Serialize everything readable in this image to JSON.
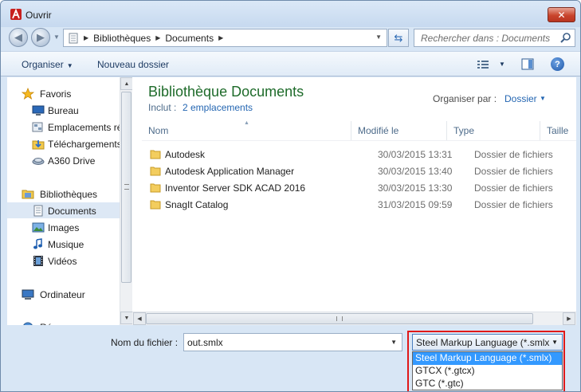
{
  "window": {
    "title": "Ouvrir",
    "close_label": "✕"
  },
  "address": {
    "segments": [
      "Bibliothèques",
      "Documents"
    ],
    "search_placeholder": "Rechercher dans : Documents"
  },
  "toolbar": {
    "organize_label": "Organiser",
    "new_folder_label": "Nouveau dossier",
    "help_label": "?"
  },
  "sidebar": {
    "items": [
      {
        "label": "Favoris",
        "icon": "star-icon",
        "indent": false
      },
      {
        "label": "Bureau",
        "icon": "desktop-icon",
        "indent": true
      },
      {
        "label": "Emplacements ré",
        "icon": "recent-places-icon",
        "indent": true
      },
      {
        "label": "Téléchargements",
        "icon": "downloads-icon",
        "indent": true
      },
      {
        "label": "A360 Drive",
        "icon": "cloud-drive-icon",
        "indent": true
      },
      {
        "label": "Bibliothèques",
        "icon": "libraries-icon",
        "indent": false
      },
      {
        "label": "Documents",
        "icon": "documents-icon",
        "indent": true,
        "selected": true
      },
      {
        "label": "Images",
        "icon": "images-icon",
        "indent": true
      },
      {
        "label": "Musique",
        "icon": "music-icon",
        "indent": true
      },
      {
        "label": "Vidéos",
        "icon": "videos-icon",
        "indent": true
      },
      {
        "label": "Ordinateur",
        "icon": "computer-icon",
        "indent": false
      },
      {
        "label": "Ré",
        "icon": "network-icon",
        "indent": false
      }
    ]
  },
  "library": {
    "title": "Bibliothèque Documents",
    "include_label": "Inclut :",
    "include_link": "2 emplacements",
    "arrange_label": "Organiser par :",
    "arrange_value": "Dossier"
  },
  "columns": [
    "Nom",
    "Modifié le",
    "Type",
    "Taille"
  ],
  "files": [
    {
      "name": "Autodesk",
      "modified": "30/03/2015 13:31",
      "type": "Dossier de fichiers"
    },
    {
      "name": "Autodesk Application Manager",
      "modified": "30/03/2015 13:40",
      "type": "Dossier de fichiers"
    },
    {
      "name": "Inventor Server SDK ACAD 2016",
      "modified": "30/03/2015 13:30",
      "type": "Dossier de fichiers"
    },
    {
      "name": "SnagIt Catalog",
      "modified": "31/03/2015 09:59",
      "type": "Dossier de fichiers"
    }
  ],
  "bottom": {
    "filename_label": "Nom du fichier :",
    "filename_value": "out.smlx",
    "filetype_selected": "Steel Markup Language (*.smlx",
    "filetype_options": [
      "Steel Markup Language (*.smlx)",
      "GTCX (*.gtcx)",
      "GTC (*.gtc)"
    ],
    "highlight_color": "#e01818",
    "selection_color": "#3399ff"
  }
}
